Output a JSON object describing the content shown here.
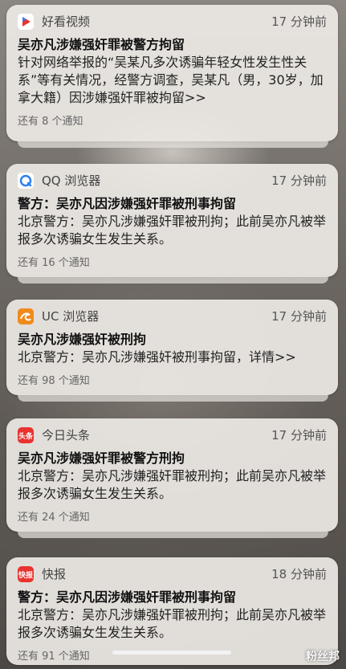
{
  "notifications": [
    {
      "app": "好看视频",
      "icon": "haokan-video-icon",
      "time": "17 分钟前",
      "title": "吴亦凡涉嫌强奸罪被警方拘留",
      "body": "针对网络举报的“吴某凡多次诱骗年轻女性发生性关系”等有关情况，经警方调查，吴某凡（男，30岁，加拿大籍）因涉嫌强奸罪被拘留>>",
      "more": "还有 8 个通知"
    },
    {
      "app": "QQ 浏览器",
      "icon": "qq-browser-icon",
      "time": "17 分钟前",
      "title": "警方：吴亦凡因涉嫌强奸罪被刑事拘留",
      "body": "北京警方：吴亦凡涉嫌强奸罪被刑拘；此前吴亦凡被举报多次诱骗女生发生关系。",
      "more": "还有 16 个通知"
    },
    {
      "app": "UC 浏览器",
      "icon": "uc-browser-icon",
      "time": "17 分钟前",
      "title": "吴亦凡涉嫌强奸被刑拘",
      "body": "北京警方：吴亦凡涉嫌强奸被刑事拘留，详情>>",
      "more": "还有 98 个通知"
    },
    {
      "app": "今日头条",
      "icon": "toutiao-icon",
      "icon_text": "头条",
      "time": "17 分钟前",
      "title": "吴亦凡涉嫌强奸罪被警方刑拘",
      "body": "北京警方：吴亦凡涉嫌强奸罪被刑拘；此前吴亦凡被举报多次诱骗女生发生关系。",
      "more": "还有 24 个通知"
    },
    {
      "app": "快报",
      "icon": "kuaibao-icon",
      "icon_text": "快报",
      "time": "18 分钟前",
      "title": "警方：吴亦凡因涉嫌强奸罪被刑事拘留",
      "body": "北京警方：吴亦凡涉嫌强奸罪被刑拘；此前吴亦凡被举报多次诱骗女生发生关系。",
      "more": "还有 91 个通知"
    }
  ],
  "watermark": "粉丝邦",
  "colors": {
    "haokan": "#e8332f",
    "qq": "#2f7ff0",
    "uc": "#f08a1c",
    "toutiao": "#e8332f",
    "kuaibao": "#e8332f"
  }
}
